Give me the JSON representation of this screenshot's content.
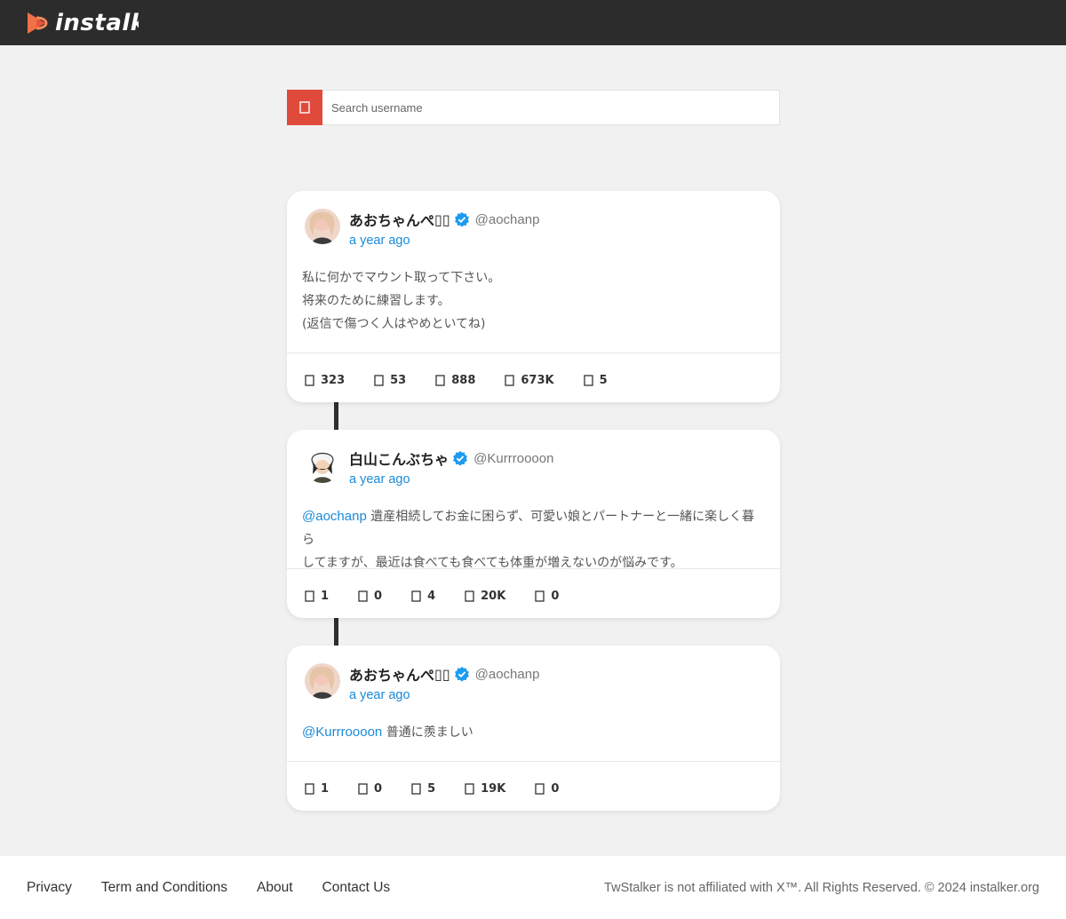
{
  "header": {
    "logo_text": "instalk"
  },
  "search": {
    "placeholder": "Search username"
  },
  "colors": {
    "topbar": "#2c2c2c",
    "accent_red": "#e04a3a",
    "link_blue": "#1a8ad8",
    "verified_blue": "#1d9bf0"
  },
  "posts": [
    {
      "display_name": "あおちゃんぺ",
      "handle": "@aochanp",
      "time": "a year ago",
      "verified": true,
      "mention": "",
      "lines": [
        "私に何かでマウント取って下さい。",
        "将来のために練習します。",
        "(返信で傷つく人はやめといてね)"
      ],
      "stats": [
        "323",
        "53",
        "888",
        "673K",
        "5"
      ]
    },
    {
      "display_name": "白山こんぶちゃ",
      "handle": "@Kurrroooon",
      "time": "a year ago",
      "verified": true,
      "mention": "@aochanp",
      "text_after_mention": " 遺産相続してお金に困らず、可愛い娘とパートナーと一緒に楽しく暮ら",
      "lines": [
        "してますが、最近は食べても食べても体重が増えないのが悩みです。"
      ],
      "stats": [
        "1",
        "0",
        "4",
        "20K",
        "0"
      ]
    },
    {
      "display_name": "あおちゃんぺ",
      "handle": "@aochanp",
      "time": "a year ago",
      "verified": true,
      "mention": "@Kurrroooon",
      "text_after_mention": " 普通に羨ましい",
      "lines": [],
      "stats": [
        "1",
        "0",
        "5",
        "19K",
        "0"
      ]
    }
  ],
  "stat_icons": [
    "reply-icon",
    "retweet-icon",
    "like-icon",
    "views-icon",
    "bookmark-icon"
  ],
  "footer": {
    "links": [
      "Privacy",
      "Term and Conditions",
      "About",
      "Contact Us"
    ],
    "notice": "TwStalker is not affiliated with X™. All Rights Reserved. © 2024 instalker.org"
  }
}
